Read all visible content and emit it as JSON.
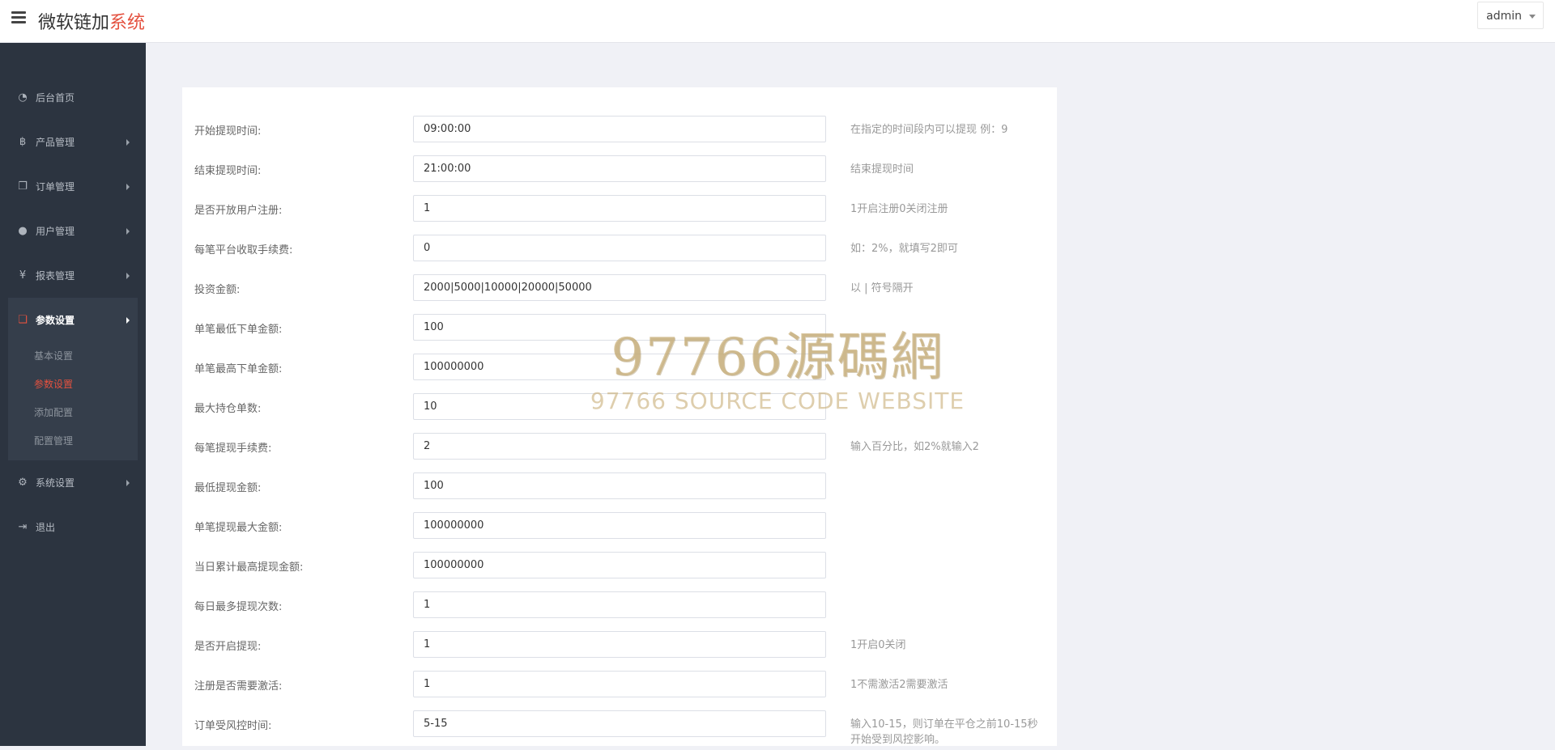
{
  "header": {
    "brand_main": "微软链加",
    "brand_accent": "系统",
    "user": "admin",
    "accent_color": "#e4513f"
  },
  "sidebar": {
    "items": [
      {
        "label": "后台首页",
        "icon": "dashboard-icon"
      },
      {
        "label": "产品管理",
        "icon": "bitcoin-icon"
      },
      {
        "label": "订单管理",
        "icon": "copy-icon"
      },
      {
        "label": "用户管理",
        "icon": "user-icon"
      },
      {
        "label": "报表管理",
        "icon": "yen-icon"
      },
      {
        "label": "参数设置",
        "icon": "files-icon"
      },
      {
        "label": "系统设置",
        "icon": "gears-icon"
      },
      {
        "label": "退出",
        "icon": "sign-out-icon"
      }
    ],
    "sub_items": [
      "基本设置",
      "参数设置",
      "添加配置",
      "配置管理"
    ],
    "active_sub": "参数设置"
  },
  "form": {
    "rows": [
      {
        "label": "开始提现时间:",
        "value": "09:00:00",
        "hint": "在指定的时间段内可以提现 例：9"
      },
      {
        "label": "结束提现时间:",
        "value": "21:00:00",
        "hint": "结束提现时间"
      },
      {
        "label": "是否开放用户注册:",
        "value": "1",
        "hint": "1开启注册0关闭注册"
      },
      {
        "label": "每笔平台收取手续费:",
        "value": "0",
        "hint": "如：2%，就填写2即可"
      },
      {
        "label": "投资金额:",
        "value": "2000|5000|10000|20000|50000",
        "hint": "以 | 符号隔开"
      },
      {
        "label": "单笔最低下单金额:",
        "value": "100",
        "hint": ""
      },
      {
        "label": "单笔最高下单金额:",
        "value": "100000000",
        "hint": ""
      },
      {
        "label": "最大持仓单数:",
        "value": "10",
        "hint": ""
      },
      {
        "label": "每笔提现手续费:",
        "value": "2",
        "hint": "输入百分比，如2%就输入2"
      },
      {
        "label": "最低提现金额:",
        "value": "100",
        "hint": ""
      },
      {
        "label": "单笔提现最大金额:",
        "value": "100000000",
        "hint": ""
      },
      {
        "label": "当日累计最高提现金额:",
        "value": "100000000",
        "hint": ""
      },
      {
        "label": "每日最多提现次数:",
        "value": "1",
        "hint": ""
      },
      {
        "label": "是否开启提现:",
        "value": "1",
        "hint": "1开启0关闭"
      },
      {
        "label": "注册是否需要激活:",
        "value": "1",
        "hint": "1不需激活2需要激活"
      },
      {
        "label": "订单受风控时间:",
        "value": "5-15",
        "hint": "输入10-15，则订单在平仓之前10-15秒开始受到风控影响。"
      }
    ]
  },
  "watermark": {
    "main": "97766源碼網",
    "sub": "97766 SOURCE CODE WEBSITE"
  }
}
